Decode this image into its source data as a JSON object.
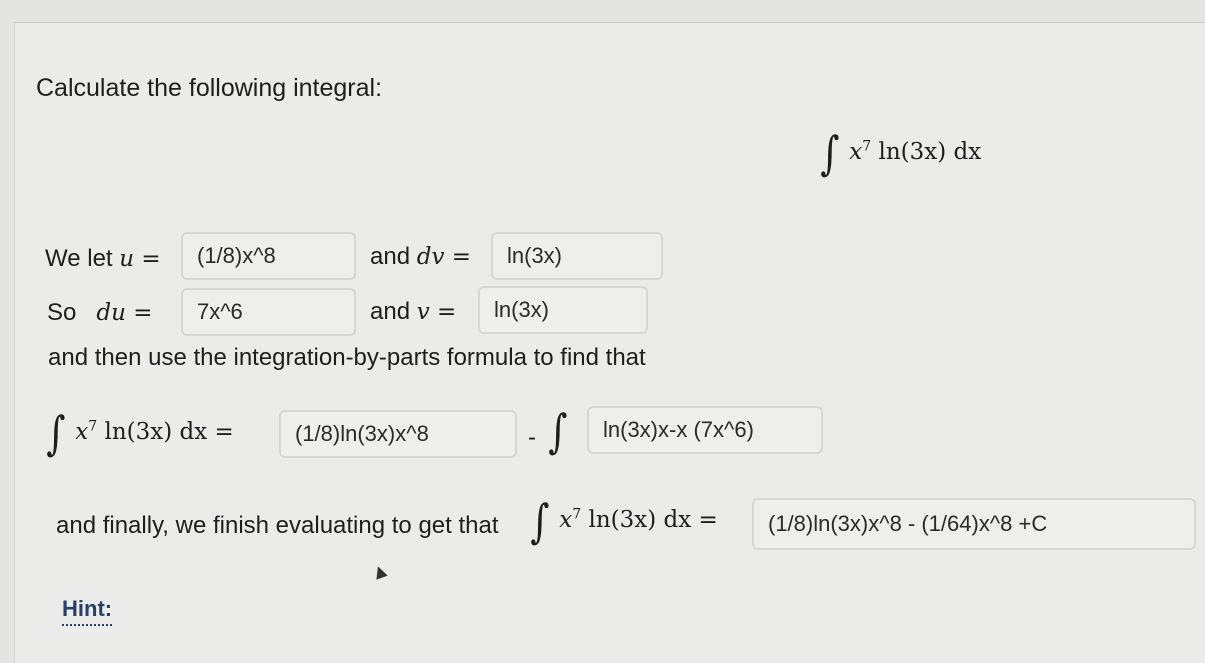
{
  "question": {
    "prompt": "Calculate the following integral:",
    "integral_expression": {
      "base": "x",
      "exponent": "7",
      "rest": " ln(3x) dx"
    }
  },
  "step1": {
    "prefix": "We let",
    "u_var": "u",
    "eq": " =",
    "u_value": "(1/8)x^8",
    "dv_label": "and",
    "dv_var": "dv",
    "dv_value": "ln(3x)"
  },
  "step2": {
    "prefix": "So",
    "du_var": "du",
    "eq": " =",
    "du_value": "7x^6",
    "v_label": "and",
    "v_var": "v",
    "v_value": "ln(3x)"
  },
  "step3": {
    "text": "and then use the integration-by-parts formula to find that",
    "uv_value": "(1/8)ln(3x)x^8",
    "minus": "-",
    "vdu_value": "ln(3x)x-x (7x^6)"
  },
  "step4": {
    "text": "and finally, we finish evaluating to get that",
    "final_value": "(1/8)ln(3x)x^8 - (1/64)x^8 +C"
  },
  "hint": {
    "label": "Hint:"
  },
  "symbols": {
    "integral": "∫",
    "equals": "="
  }
}
